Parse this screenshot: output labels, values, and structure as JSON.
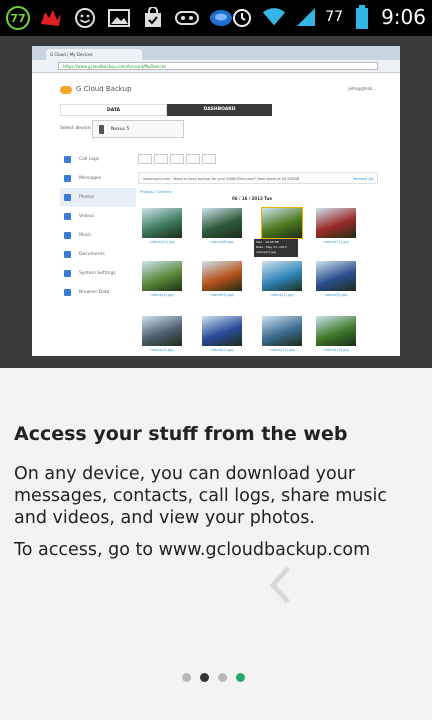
{
  "status_bar": {
    "notif_badge": "77",
    "battery_level": "77",
    "time": "9:06"
  },
  "screenshot": {
    "browser_tab": "G Cloud | My Devices",
    "url": "https://www.gcloudbackup.com/Account/MyDevices",
    "app_name": "G Cloud Backup",
    "user": "john@gmail...",
    "tabs": [
      "DATA",
      "DASHBOARD"
    ],
    "select_device_label": "Select device:",
    "device_name": "Nexus 5",
    "sidebar": [
      "Call Logs",
      "Messages",
      "Photos",
      "Videos",
      "Music",
      "Documents",
      "System Settings",
      "Browser Data"
    ],
    "banner_text": "www.zoolo.com - Need a cloud backup for your 50/60/Everyone? Deal starts at $5/100GB",
    "banner_link": "Remove Ad",
    "breadcrumb": "Photos / Camera",
    "date_header": "06 / 16 / 2013 Tue",
    "tooltip_lines": [
      "Size : 19.65 KB",
      "Date : May 31, 2013",
      "nature(7).jpg"
    ],
    "thumbs": [
      {
        "caption": "nature(20).jpg",
        "color": "#3c7b5e"
      },
      {
        "caption": "nature(8).jpg",
        "color": "#2f5b3a"
      },
      {
        "caption": "nature(7).jpg",
        "color": "#4d7a1f"
      },
      {
        "caption": "nature(12).jpg",
        "color": "#9a2a28"
      },
      {
        "caption": "nature(4).jpg",
        "color": "#5a8a3a"
      },
      {
        "caption": "nature(5).jpg",
        "color": "#b8521a"
      },
      {
        "caption": "nature(1).jpg",
        "color": "#2f84b8"
      },
      {
        "caption": "nature(9).jpg",
        "color": "#2c4f8f"
      },
      {
        "caption": "nature(3).jpg",
        "color": "#4f6070"
      },
      {
        "caption": "nature(2).jpg",
        "color": "#2a4a9a"
      },
      {
        "caption": "nature(11).jpg",
        "color": "#3b6a90"
      },
      {
        "caption": "nature(15).jpg",
        "color": "#3f7a2a"
      }
    ]
  },
  "onboarding": {
    "heading": "Access your stuff from the web",
    "body": "On any device, you can download your messages, contacts, call logs, share music and videos, and view your photos.",
    "access_line": "To access, go to www.gcloudbackup.com"
  },
  "pager": {
    "colors": [
      "#b8b8b8",
      "#333333",
      "#b8b8b8",
      "#2aa56a"
    ]
  }
}
